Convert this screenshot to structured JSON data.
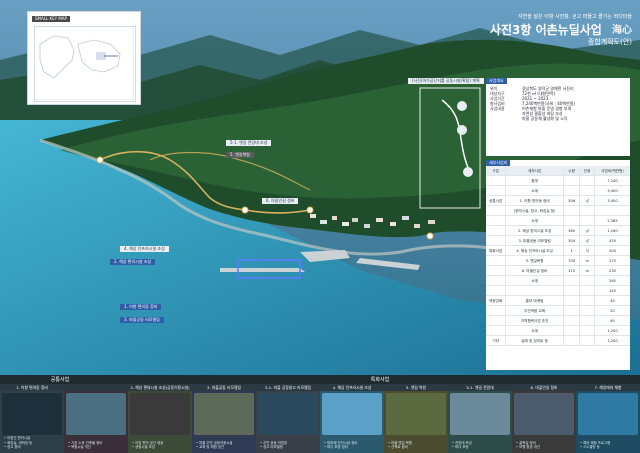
{
  "colors": {
    "sea": "#36a3c6",
    "sea_dark": "#1b6f93",
    "forest": "#1f4d2b",
    "forest_light": "#2f6a3a",
    "route": "#d9b25f",
    "label_blue": "#2f5fa7",
    "label_dark": "#5b5b5b",
    "panel_head": "#2f5fa7",
    "bottom_bg": "#0e2a2f"
  },
  "inset_map": {
    "title": "SMALL KEY MAP"
  },
  "title": {
    "sub_line_1": "자연을 닮은 어항 사진항, 걷고 머물고 즐기는 바다마을",
    "sub_line_2": "",
    "main": "사진3항 어촌뉴딜사업",
    "sub_main": "종합계획도(안)",
    "seal": "海心"
  },
  "map": {
    "aerial_note": "[사진]어가공단지를 공동시설(확장) 계획",
    "labels": [
      {
        "id": "l1",
        "text": "5-1. 옛길 전망대 조성",
        "type": "light"
      },
      {
        "id": "l2",
        "text": "5. 옛길복원",
        "type": "dark"
      },
      {
        "id": "l3",
        "text": "6. 마을안길 정비",
        "type": "light"
      },
      {
        "id": "l4",
        "text": "4. 해상 인프라시설 조성",
        "type": "light"
      },
      {
        "id": "l5",
        "text": "2. 해상 편의시설 조성",
        "type": "blue"
      },
      {
        "id": "l6",
        "text": "1. 어항 편의동 정비",
        "type": "blue"
      },
      {
        "id": "l7",
        "text": "3. 마을공동 리모델링",
        "type": "blue"
      }
    ]
  },
  "panel": {
    "overview_title": "사업개요",
    "overview_rows": [
      {
        "k": "위치",
        "v": "경상북도 영덕군 영해면 사진리"
      },
      {
        "k": "대상지구",
        "v": "72천 ㎡ (내항면적)"
      },
      {
        "k": "사업기간",
        "v": "2021 ~ 2023"
      },
      {
        "k": "총사업비",
        "v": "7,240백만원(국비 : 40백만원)"
      },
      {
        "k": "사업내용",
        "v": "어촌체험 마을 운영 경험 부여"
      }
    ],
    "overview_extra": [
      "자연성 결합성 바탕 조성",
      "마을 공동체 활성화 및 소득"
    ],
    "detail_title": "세부사업비",
    "table_header": [
      "구분",
      "세부사업",
      "수량",
      "단위",
      "사업비(백만원)"
    ],
    "rows": [
      {
        "c1": "",
        "c2": "합계",
        "c3": "",
        "c4": "",
        "c5": "7,240"
      },
      {
        "c1": "",
        "c2": "소계",
        "c3": "",
        "c4": "",
        "c5": "3,400"
      },
      {
        "c1": "공통사업",
        "c2": "1. 어항 편의동 정비",
        "c3": "306",
        "c4": "㎡",
        "c5": "3,400"
      },
      {
        "c1": "",
        "c2": "(편의시설, 창고, 화장실 등)",
        "c3": "",
        "c4": "",
        "c5": ""
      },
      {
        "c1": "",
        "c2": "소계",
        "c3": "",
        "c4": "",
        "c5": "2,385"
      },
      {
        "c1": "",
        "c2": "2. 해상 편의시설 조성",
        "c3": "360",
        "c4": "㎡",
        "c5": "1,160"
      },
      {
        "c1": "",
        "c2": "3. 마을공동 리모델링",
        "c3": "300",
        "c4": "㎡",
        "c5": "420"
      },
      {
        "c1": "특화사업",
        "c2": "4. 해상 인프라시설 조성",
        "c3": "1",
        "c4": "식",
        "c5": "300"
      },
      {
        "c1": "",
        "c2": "5. 옛길복원",
        "c3": "700",
        "c4": "m",
        "c5": "275"
      },
      {
        "c1": "",
        "c2": "6. 마을안길 정비",
        "c3": "315",
        "c4": "m",
        "c5": "230"
      },
      {
        "c1": "",
        "c2": "소계",
        "c3": "",
        "c4": "",
        "c5": "265"
      },
      {
        "c1": "",
        "c2": "",
        "c3": "",
        "c4": "",
        "c5": "145"
      },
      {
        "c1": "역량강화",
        "c2": "홍보 마케팅",
        "c3": "",
        "c4": "",
        "c5": "40"
      },
      {
        "c1": "",
        "c2": "주민역량 교육",
        "c3": "",
        "c4": "",
        "c5": "20"
      },
      {
        "c1": "",
        "c2": "지역협력사업 추진",
        "c3": "",
        "c4": "",
        "c5": "60"
      },
      {
        "c1": "",
        "c2": "소계",
        "c3": "",
        "c4": "",
        "c5": "1,200"
      },
      {
        "c1": "기타",
        "c2": "설계 및 감리비 등",
        "c3": "",
        "c4": "",
        "c5": "1,200"
      }
    ]
  },
  "bottom": {
    "common_title": "공통사업",
    "special_title": "특화사업",
    "cards": [
      {
        "title": "1. 어항 편의동 정비",
        "desc": [
          "어업인 편의시설",
          "화장실, 세척장 등",
          "창고 정비"
        ]
      },
      {
        "title": "",
        "desc": [
          "기존 노후 건축물 정비",
          "복합시설 개선"
        ]
      },
      {
        "title": "2. 해상 편의시설 조성(공동이용시설)",
        "desc": [
          "어업 편의 공간 제공",
          "공동시설 조성"
        ]
      },
      {
        "title": "3. 마을공동 리모델링",
        "desc": [
          "마을 주민 공동이용시설",
          "교육 및 체험 공간"
        ]
      },
      {
        "title": "3-1. 마을 공동창고 리모델링",
        "desc": [
          "주민 공동 작업장",
          "창고 리모델링"
        ]
      },
      {
        "title": "4. 해상 인프라시설 조성",
        "desc": [
          "방파제 안전시설 정비",
          "바다 조망 쉼터"
        ]
      },
      {
        "title": "5. 옛길 복원",
        "desc": [
          "마을 옛길 복원",
          "산책로 정비"
        ]
      },
      {
        "title": "5-1. 옛길 전망대",
        "desc": [
          "전망대 조성",
          "바다 조망"
        ]
      },
      {
        "title": "6. 마을안길 정비",
        "desc": [
          "골목길 정비",
          "보행 환경 개선"
        ]
      },
      {
        "title": "7. 해양레저 체험",
        "desc": [
          "해양 체험 프로그램",
          "스노클링 등"
        ]
      }
    ]
  }
}
